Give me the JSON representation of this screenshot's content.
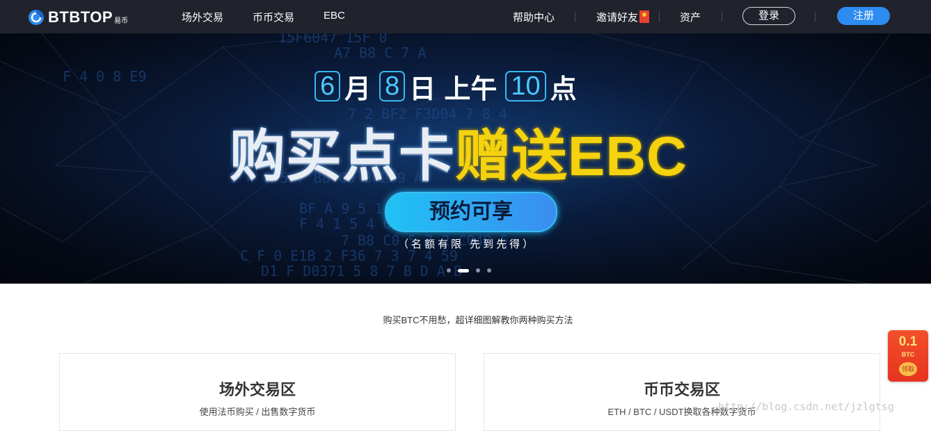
{
  "header": {
    "logo_text": "BTBTOP",
    "logo_sub": "易币",
    "nav": [
      "场外交易",
      "币币交易",
      "EBC"
    ],
    "right_nav": [
      "帮助中心",
      "邀请好友",
      "资产"
    ],
    "login_label": "登录",
    "register_label": "注册"
  },
  "banner": {
    "date_parts": [
      "6",
      "月",
      "8",
      "日",
      "上午",
      "10",
      "点"
    ],
    "headline_white": "购买点卡",
    "headline_yellow": "赠送EBC",
    "cta_label": "预约可享",
    "cta_note": "（名额有限 先到先得）",
    "hex_rows": [
      "15F6047 15F 0",
      "A7 B8 C 7 A",
      "F 4 0 8 E9",
      "7 2 BF2 F3D04 7 8 4",
      "9 4 8 5 7 B8 C0 BF2 9 A",
      "BF A 9 5 1 F 2 2 7 4 8",
      "F 4 1 5 4 0 C 82 C E",
      "7 B8 C0 5 7 2 C04D 5",
      "C F 0 E1B 2 F36 7 3 7 4 59",
      "D1 F D0371 5 8 7 B D A B"
    ],
    "slides": 4,
    "active_slide": 1
  },
  "content": {
    "tagline": "购买BTC不用愁，超详细图解教你两种购买方法",
    "cards": [
      {
        "title": "场外交易区",
        "desc": "使用法币购买 / 出售数字货币"
      },
      {
        "title": "币币交易区",
        "desc": "ETH / BTC / USDT换取各种数字货币"
      }
    ]
  },
  "reward": {
    "amount": "0.1",
    "unit": "BTC",
    "button": "领取"
  },
  "watermark": "http://blog.csdn.net/jzlgtsg"
}
